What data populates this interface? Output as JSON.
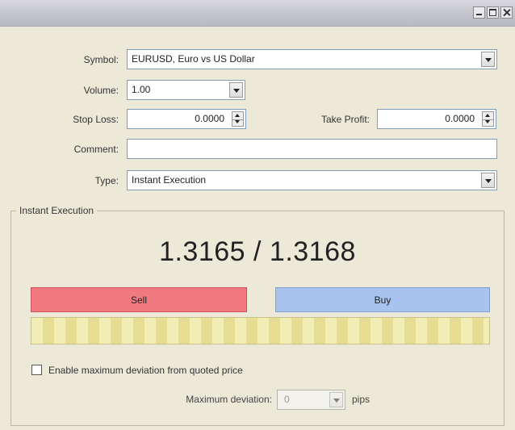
{
  "window": {
    "minimize_label": "_",
    "maximize_label": "□",
    "close_label": "×"
  },
  "form": {
    "symbol_label": "Symbol:",
    "symbol_value": "EURUSD, Euro vs US Dollar",
    "volume_label": "Volume:",
    "volume_value": "1.00",
    "stop_loss_label": "Stop Loss:",
    "stop_loss_value": "0.0000",
    "take_profit_label": "Take Profit:",
    "take_profit_value": "0.0000",
    "comment_label": "Comment:",
    "comment_value": "",
    "type_label": "Type:",
    "type_value": "Instant Execution"
  },
  "execution": {
    "group_title": "Instant Execution",
    "bid": "1.3165",
    "ask": "1.3168",
    "separator": " / ",
    "sell_label": "Sell",
    "buy_label": "Buy",
    "sell_color": "#f07a7f",
    "buy_color": "#a8c4ee",
    "close_button_color": "#f2ecb5",
    "enable_deviation_label": "Enable maximum deviation from quoted price",
    "enable_deviation_checked": false,
    "max_deviation_label": "Maximum deviation:",
    "max_deviation_value": "0",
    "pips_label": "pips"
  }
}
